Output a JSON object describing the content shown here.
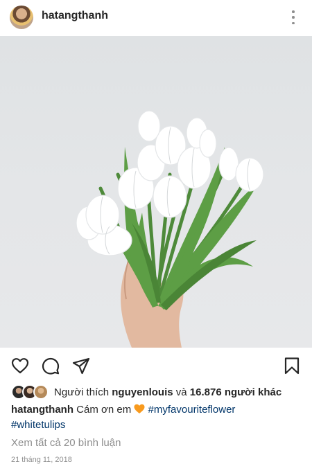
{
  "header": {
    "username": "hatangthanh"
  },
  "icons": {
    "like": "heart-outline-icon",
    "comment": "comment-bubble-icon",
    "share": "paper-plane-icon",
    "save": "bookmark-icon",
    "more": "vertical-ellipsis-icon"
  },
  "likes": {
    "prefix": "Người thích",
    "first_user": "nguyenlouis",
    "joiner": "và",
    "others": "16.876 người khác"
  },
  "caption": {
    "username": "hatangthanh",
    "text": "Cám ơn em",
    "emoji": "orange-heart",
    "hashtags": [
      "#myfavouriteflower",
      "#whitetulips"
    ]
  },
  "comments": {
    "link": "Xem tất cả 20 bình luận"
  },
  "date": "21 tháng 11, 2018",
  "colors": {
    "text": "#262626",
    "secondary": "#8e8e8e",
    "hashtag": "#003569",
    "heart": "#f89a1e"
  }
}
